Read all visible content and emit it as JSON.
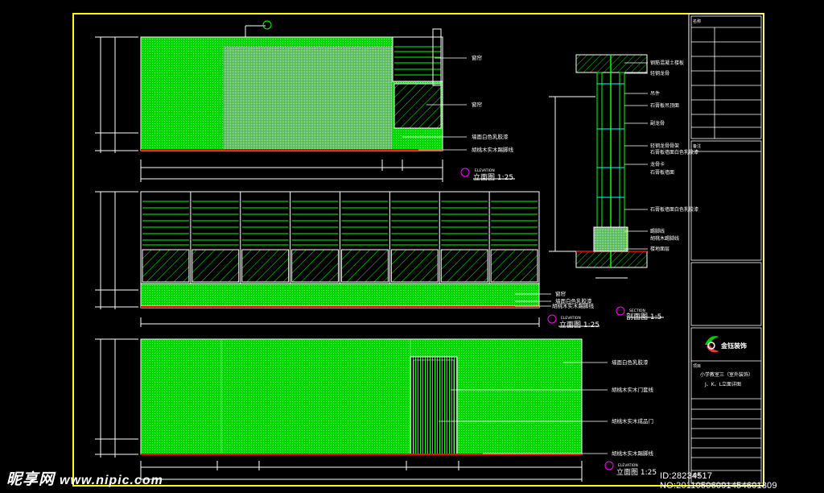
{
  "drawing": {
    "frame_color": "#ffff00",
    "line_color": "#ffffff",
    "fill_color": "#00ff00",
    "red_color": "#ff0000",
    "cyan_color": "#00ffff",
    "elevation_a": {
      "caption_small": "ELEVATION",
      "caption": "立面图 1:25",
      "labels": [
        "窗帘",
        "窗帘",
        "墙面白色乳胶漆",
        "胡桃木实木踢脚线"
      ]
    },
    "elevation_b": {
      "caption_small": "ELEVATION",
      "caption": "立面图 1:25",
      "labels": [
        "窗帘",
        "墙面白色乳胶漆",
        "胡桃木实木踢脚线"
      ]
    },
    "elevation_c": {
      "caption_small": "ELEVATION",
      "caption": "立面图 1:25",
      "labels": [
        "墙面白色乳胶漆",
        "胡桃木实木门套线",
        "胡桃木实木成品门",
        "胡桃木实木踢脚线"
      ]
    },
    "section": {
      "caption_small": "SECTION",
      "caption": "剖面图 1:5",
      "labels": [
        "钢筋混凝土楼板",
        "轻钢龙骨",
        "吊件",
        "石膏板吊顶面",
        "副龙骨",
        "轻钢龙骨骨架",
        "石膏板墙面白色乳胶漆",
        "龙骨卡",
        "石膏板墙面",
        "石膏板墙面白色乳胶漆",
        "踢脚线",
        "胡桃木踢脚线",
        "楼地面层"
      ]
    },
    "title_block": {
      "company": "金钰装饰",
      "project": "小学教室三（室外装饰）",
      "drawing_name": "J、K、L立面详图",
      "labels": [
        "名称",
        "备注",
        "项目",
        "图号"
      ]
    }
  },
  "watermark": {
    "site": "昵享网",
    "url": "www.nipic.com",
    "id_text": "ID:28234517 NO:20110506091454601309"
  }
}
